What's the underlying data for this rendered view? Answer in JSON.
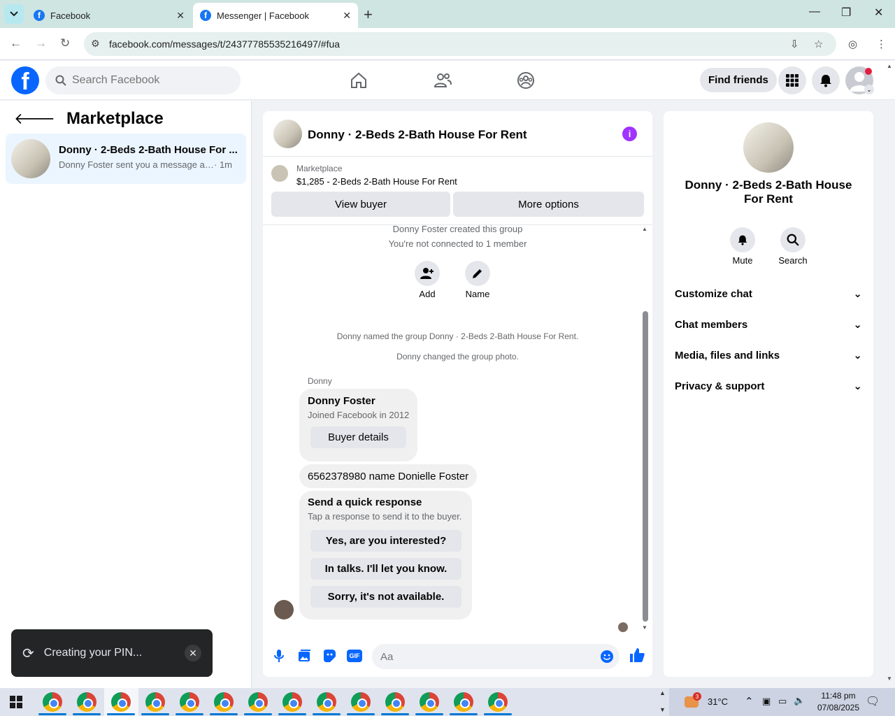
{
  "browser": {
    "tabs": [
      {
        "title": "Facebook",
        "active": false
      },
      {
        "title": "Messenger | Facebook",
        "active": true
      }
    ],
    "new_tab": "+",
    "url": "facebook.com/messages/t/24377785535216497/#fua"
  },
  "header": {
    "logo": "f",
    "search_placeholder": "Search Facebook",
    "find_friends": "Find friends"
  },
  "left": {
    "title": "Marketplace",
    "conversation": {
      "name": "Donny · 2-Beds 2-Bath House For ...",
      "preview": "Donny Foster sent you a message ab...",
      "time": "· 1m"
    }
  },
  "toast": {
    "text": "Creating your PIN..."
  },
  "chat": {
    "title": "Donny · 2-Beds 2-Bath House For Rent",
    "info": "i",
    "marketplace_label": "Marketplace",
    "listing": "$1,285 - 2-Beds 2-Bath House For Rent",
    "view_buyer": "View buyer",
    "more_options": "More options",
    "created": "Donny Foster created this group",
    "not_connected": "You're not connected to 1 member",
    "add_label": "Add",
    "name_label": "Name",
    "named_group": "Donny named the group Donny · 2-Beds 2-Bath House For Rent.",
    "changed_photo": "Donny changed the group photo.",
    "sender": "Donny",
    "profile_name": "Donny Foster",
    "joined": "Joined Facebook in 2012",
    "buyer_details": "Buyer details",
    "message": "6562378980 name Donielle Foster",
    "quick_title": "Send a quick response",
    "quick_sub": "Tap a response to send it to the buyer.",
    "quick_responses": [
      "Yes, are you interested?",
      "In talks. I'll let you know.",
      "Sorry, it's not available."
    ],
    "composer_placeholder": "Aa",
    "gif": "GIF"
  },
  "right": {
    "name": "Donny · 2-Beds 2-Bath House For Rent",
    "mute": "Mute",
    "search": "Search",
    "sections": [
      "Customize chat",
      "Chat members",
      "Media, files and links",
      "Privacy & support"
    ]
  },
  "taskbar": {
    "temperature": "31°C",
    "badge": "3",
    "time": "11:48 pm",
    "date": "07/08/2025"
  },
  "colors": {
    "facebook_blue": "#0866ff",
    "info_purple": "#a033ff",
    "selected_conv": "#ebf5ff"
  }
}
